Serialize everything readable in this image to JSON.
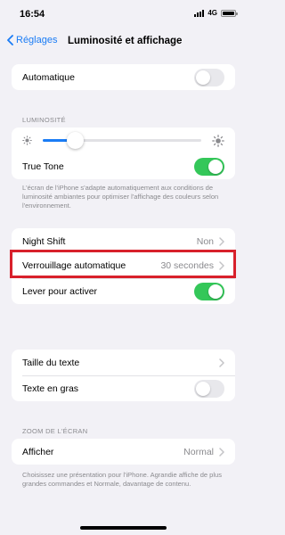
{
  "status_bar": {
    "time": "16:54",
    "network": "4G"
  },
  "nav": {
    "back_label": "Réglages",
    "title": "Luminosité et affichage"
  },
  "appearance": {
    "automatic_label": "Automatique",
    "automatic_on": false
  },
  "brightness": {
    "header": "LUMINOSITÉ",
    "level": 0.2,
    "true_tone_label": "True Tone",
    "true_tone_on": true,
    "footer": "L'écran de l'iPhone s'adapte automatiquement aux conditions de luminosité ambiantes pour optimiser l'affichage des couleurs selon l'environnement."
  },
  "night_shift": {
    "label": "Night Shift",
    "value": "Non"
  },
  "lock": {
    "auto_lock_label": "Verrouillage automatique",
    "auto_lock_value": "30 secondes",
    "raise_to_wake_label": "Lever pour activer",
    "raise_to_wake_on": true,
    "highlight_color": "#d8202b"
  },
  "text": {
    "size_label": "Taille du texte",
    "bold_label": "Texte en gras",
    "bold_on": false
  },
  "zoom": {
    "header": "ZOOM DE L'ÉCRAN",
    "view_label": "Afficher",
    "view_value": "Normal",
    "footer": "Choisissez une présentation pour l'iPhone. Agrandie affiche de plus grandes commandes et Normale, davantage de contenu."
  },
  "colors": {
    "accent": "#1a7cf5",
    "toggle_on": "#34c759",
    "toggle_off": "#e8e8ec"
  }
}
